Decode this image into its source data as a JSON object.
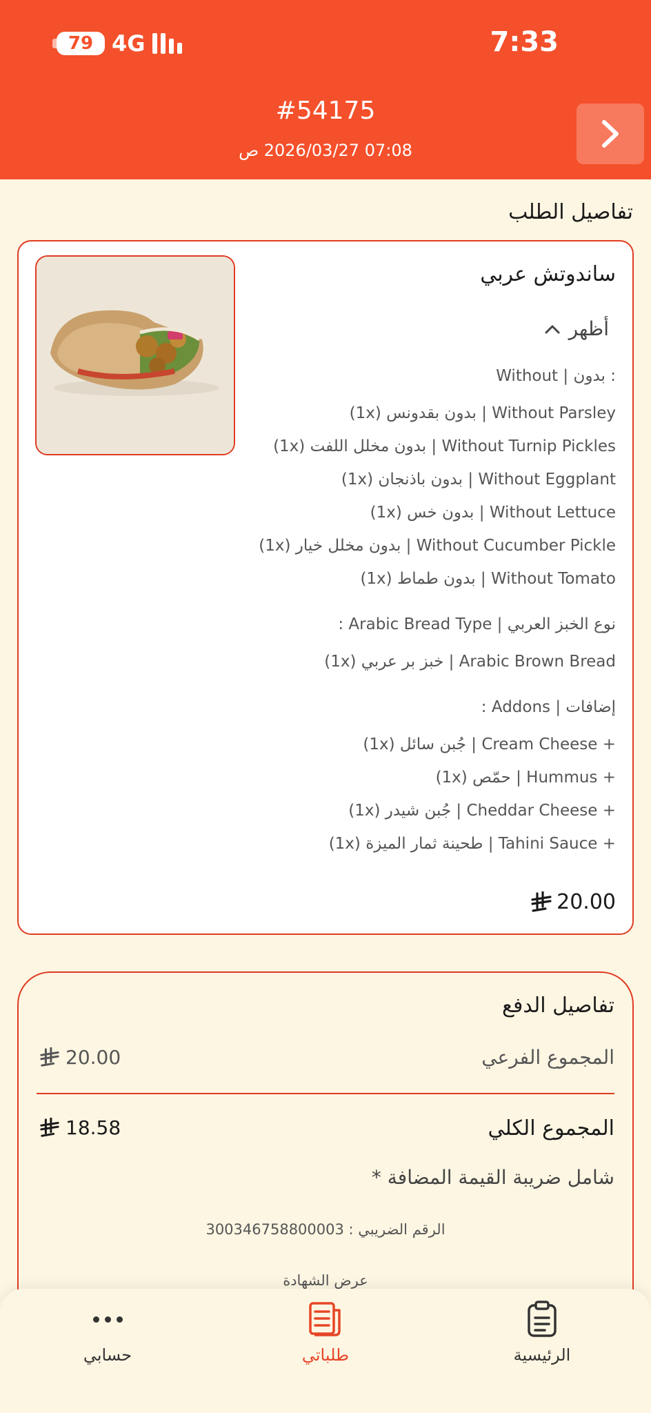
{
  "status_bar": {
    "battery": "79",
    "network": "4G",
    "time": "7:33"
  },
  "header": {
    "order_number": "#54175",
    "order_date": "07:08 2026/03/27 ص",
    "back_icon": "chevron-right-icon"
  },
  "order_details": {
    "title": "تفاصيل الطلب",
    "item": {
      "name": "ساندوتش عربي",
      "toggle_label": "أظهر",
      "groups": [
        {
          "title": "Without | بدون :",
          "options": [
            "(1x) بدون بقدونس | Without Parsley",
            "(1x) بدون مخلل اللفت | Without Turnip Pickles",
            "(1x) بدون باذنجان | Without Eggplant",
            "(1x) بدون خس | Without Lettuce",
            "(1x) بدون مخلل خيار | Without Cucumber Pickle",
            "(1x) بدون طماط | Without Tomato"
          ]
        },
        {
          "title": "نوع الخبز العربي | Arabic Bread Type :",
          "options": [
            "(1x) خبز بر عربي | Arabic Brown Bread"
          ]
        },
        {
          "title": "إضافات | Addons :",
          "options": [
            "(1x) جُبن سائل | Cream Cheese +",
            "(1x) حمّص | Hummus +",
            "(1x) جُبن شيدر | Cheddar Cheese +",
            "(1x) طحينة ثمار الميزة | Tahini Sauce +"
          ]
        }
      ],
      "price": "20.00"
    }
  },
  "payment": {
    "title": "تفاصيل الدفع",
    "subtotal_label": "المجموع الفرعي",
    "subtotal_value": "20.00",
    "total_label": "المجموع الكلي",
    "total_value": "18.58",
    "vat_note": "شامل ضريبة القيمة المضافة *",
    "tax_number": "الرقم الضريبي : 300346758800003",
    "certificate_link": "عرض الشهادة"
  },
  "bottom_nav": {
    "account": "حسابي",
    "orders": "طلباتي",
    "home": "الرئيسية"
  },
  "colors": {
    "brand": "#f4502b",
    "accent": "#e03b22",
    "background": "#fdf6e3"
  }
}
